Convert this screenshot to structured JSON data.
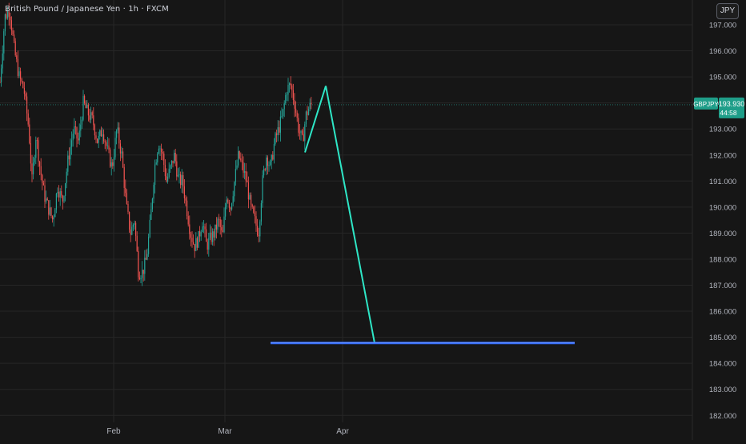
{
  "header": {
    "title": "British Pound / Japanese Yen · 1h · FXCM",
    "currency_button": "JPY"
  },
  "price_tag": {
    "symbol": "GBPJPY",
    "price": "193.930",
    "countdown": "44:58",
    "color": "#1f9e89"
  },
  "colors": {
    "background": "#161616",
    "grid": "#262626",
    "bull": "#26a69a",
    "bear": "#ef5350",
    "projection": "#2ee6c6",
    "target_line": "#2962ff"
  },
  "chart_data": {
    "type": "candlestick",
    "symbol": "GBPJPY",
    "timeframe": "1h",
    "source": "FXCM",
    "y_axis": {
      "range": [
        181.8,
        197.6
      ],
      "ticks": [
        "197.000",
        "196.000",
        "195.000",
        "194.000",
        "193.000",
        "192.000",
        "191.000",
        "190.000",
        "189.000",
        "188.000",
        "187.000",
        "186.000",
        "185.000",
        "184.000",
        "183.000",
        "182.000"
      ]
    },
    "x_axis": {
      "ticks": [
        "Feb",
        "Mar",
        "Apr"
      ]
    },
    "price_path": [
      [
        0,
        194.8
      ],
      [
        6,
        197.3
      ],
      [
        12,
        197.6
      ],
      [
        18,
        196.0
      ],
      [
        24,
        195.0
      ],
      [
        30,
        194.5
      ],
      [
        36,
        193.0
      ],
      [
        40,
        191.0
      ],
      [
        45,
        192.8
      ],
      [
        50,
        191.5
      ],
      [
        55,
        190.5
      ],
      [
        60,
        190.0
      ],
      [
        66,
        189.5
      ],
      [
        72,
        190.8
      ],
      [
        78,
        190.2
      ],
      [
        85,
        191.8
      ],
      [
        92,
        193.0
      ],
      [
        98,
        192.5
      ],
      [
        104,
        194.0
      ],
      [
        110,
        193.6
      ],
      [
        116,
        193.3
      ],
      [
        122,
        192.5
      ],
      [
        128,
        193.0
      ],
      [
        134,
        192.2
      ],
      [
        140,
        191.5
      ],
      [
        146,
        193.0
      ],
      [
        152,
        192.0
      ],
      [
        158,
        190.0
      ],
      [
        163,
        189.0
      ],
      [
        168,
        189.5
      ],
      [
        173,
        187.5
      ],
      [
        178,
        187.5
      ],
      [
        183,
        188.0
      ],
      [
        188,
        189.5
      ],
      [
        193,
        191.5
      ],
      [
        198,
        192.5
      ],
      [
        203,
        192.0
      ],
      [
        208,
        191.0
      ],
      [
        213,
        191.5
      ],
      [
        218,
        192.0
      ],
      [
        223,
        191.0
      ],
      [
        228,
        191.0
      ],
      [
        233,
        190.0
      ],
      [
        238,
        189.0
      ],
      [
        243,
        188.5
      ],
      [
        248,
        188.8
      ],
      [
        253,
        189.5
      ],
      [
        258,
        188.5
      ],
      [
        263,
        188.8
      ],
      [
        268,
        189.0
      ],
      [
        273,
        189.5
      ],
      [
        278,
        188.8
      ],
      [
        283,
        190.5
      ],
      [
        288,
        190.0
      ],
      [
        293,
        191.0
      ],
      [
        298,
        192.0
      ],
      [
        303,
        191.5
      ],
      [
        308,
        191.0
      ],
      [
        313,
        190.0
      ],
      [
        318,
        189.5
      ],
      [
        323,
        189.0
      ],
      [
        328,
        191.0
      ],
      [
        333,
        192.0
      ],
      [
        338,
        191.5
      ],
      [
        343,
        192.5
      ],
      [
        348,
        193.0
      ],
      [
        353,
        193.5
      ],
      [
        358,
        194.5
      ],
      [
        363,
        194.7
      ],
      [
        368,
        194.0
      ],
      [
        373,
        193.0
      ],
      [
        378,
        192.5
      ],
      [
        382,
        193.5
      ],
      [
        386,
        193.8
      ],
      [
        389,
        193.93
      ]
    ],
    "current_price": 193.93,
    "projection": [
      [
        381,
        192.1
      ],
      [
        407,
        194.65
      ],
      [
        468,
        184.78
      ]
    ],
    "target_level": {
      "price": 184.78,
      "x_range": [
        338,
        718
      ]
    }
  }
}
